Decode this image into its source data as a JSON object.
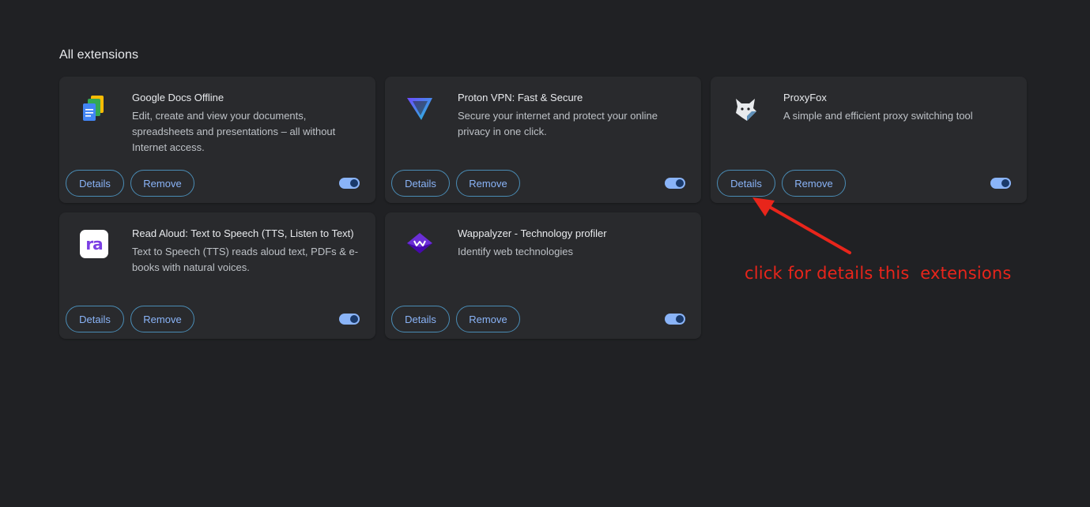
{
  "section": {
    "title": "All extensions"
  },
  "extensions": [
    {
      "name": "Google Docs Offline",
      "description": "Edit, create and view your documents, spreadsheets and presentations – all without Internet access.",
      "icon": "google-docs-icon",
      "details_label": "Details",
      "remove_label": "Remove",
      "enabled": true
    },
    {
      "name": "Proton VPN: Fast & Secure",
      "description": "Secure your internet and protect your online privacy in one click.",
      "icon": "proton-vpn-icon",
      "details_label": "Details",
      "remove_label": "Remove",
      "enabled": true
    },
    {
      "name": "ProxyFox",
      "description": "A simple and efficient proxy switching tool",
      "icon": "proxyfox-icon",
      "details_label": "Details",
      "remove_label": "Remove",
      "enabled": true
    },
    {
      "name": "Read Aloud: Text to Speech (TTS, Listen to Text)",
      "description": "Text to Speech (TTS) reads aloud text, PDFs & e-books with natural voices.",
      "icon": "read-aloud-icon",
      "icon_text": "ra",
      "details_label": "Details",
      "remove_label": "Remove",
      "enabled": true
    },
    {
      "name": "Wappalyzer - Technology profiler",
      "description": "Identify web technologies",
      "icon": "wappalyzer-icon",
      "details_label": "Details",
      "remove_label": "Remove",
      "enabled": true
    }
  ],
  "annotation": {
    "text": "click for details this  extensions",
    "color": "#e8251b"
  },
  "colors": {
    "background": "#202124",
    "card": "#292a2d",
    "accent": "#8ab4f8"
  }
}
